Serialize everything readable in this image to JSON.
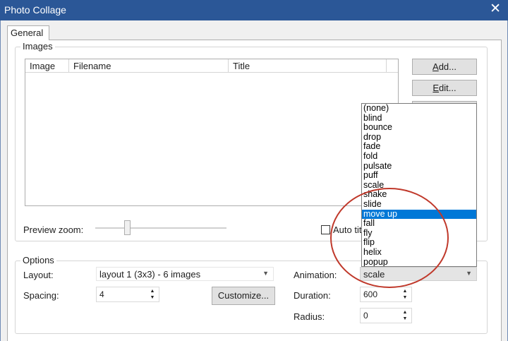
{
  "window": {
    "title": "Photo Collage",
    "close_glyph": "✕"
  },
  "tabs": [
    {
      "label": "General",
      "active": true
    }
  ],
  "images_group": {
    "label": "Images",
    "columns": [
      "Image",
      "Filename",
      "Title"
    ],
    "buttons": {
      "add": {
        "underline": "A",
        "rest": "dd..."
      },
      "edit": {
        "underline": "E",
        "rest": "dit..."
      }
    },
    "preview_zoom_label": "Preview zoom:",
    "auto_title_label": "Auto tit",
    "auto_title_checked": false
  },
  "options_group": {
    "label": "Options",
    "layout_label": "Layout:",
    "layout_value": "layout 1 (3x3) - 6 images",
    "spacing_label": "Spacing:",
    "spacing_value": "4",
    "customize_label": "Customize...",
    "animation_label": "Animation:",
    "animation_value": "scale",
    "duration_label": "Duration:",
    "duration_value": "600",
    "radius_label": "Radius:",
    "radius_value": "0"
  },
  "animation_dropdown": {
    "options": [
      "(none)",
      "blind",
      "bounce",
      "drop",
      "fade",
      "fold",
      "pulsate",
      "puff",
      "scale",
      "shake",
      "slide",
      "move up",
      "fall",
      "fly",
      "flip",
      "helix",
      "popup"
    ],
    "highlighted": "move up"
  },
  "colors": {
    "titlebar": "#2b5797",
    "selection": "#0078d7",
    "annotation_circle": "#c0392b"
  },
  "icons": {
    "close": "close-icon",
    "combo_arrow": "chevron-down-icon",
    "spin_up": "spin-up-icon",
    "spin_down": "spin-down-icon"
  }
}
